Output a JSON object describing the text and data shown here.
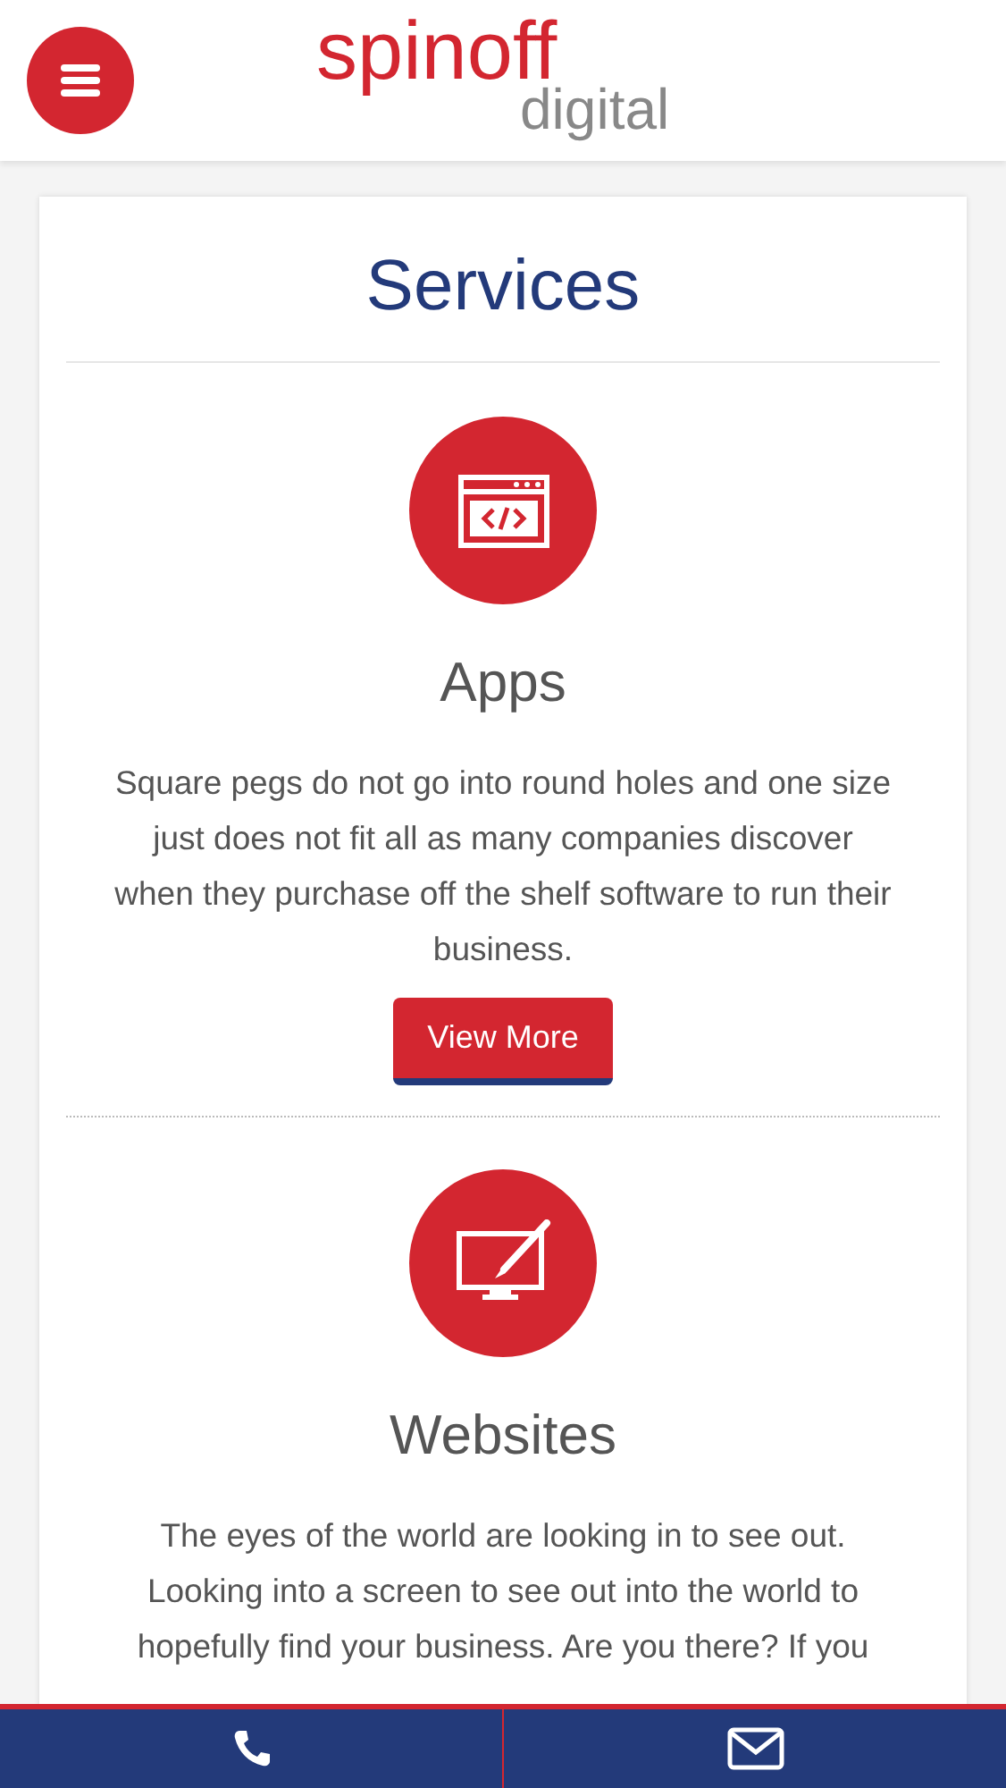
{
  "header": {
    "logo_main": "spinoff",
    "logo_sub": "digital"
  },
  "section": {
    "title": "Services"
  },
  "services": [
    {
      "kind": "code",
      "title": "Apps",
      "text": "Square pegs do not go into round holes and one size just does not fit all as many companies discover when they purchase off the shelf software to run their business.",
      "button": "View More"
    },
    {
      "kind": "design",
      "title": "Websites",
      "text": "The eyes of the world are looking in to see out. Looking into a screen to see out into the world to hopefully find your business. Are you there? If you"
    }
  ],
  "bottom_bar": [
    {
      "kind": "phone"
    },
    {
      "kind": "mail"
    }
  ]
}
